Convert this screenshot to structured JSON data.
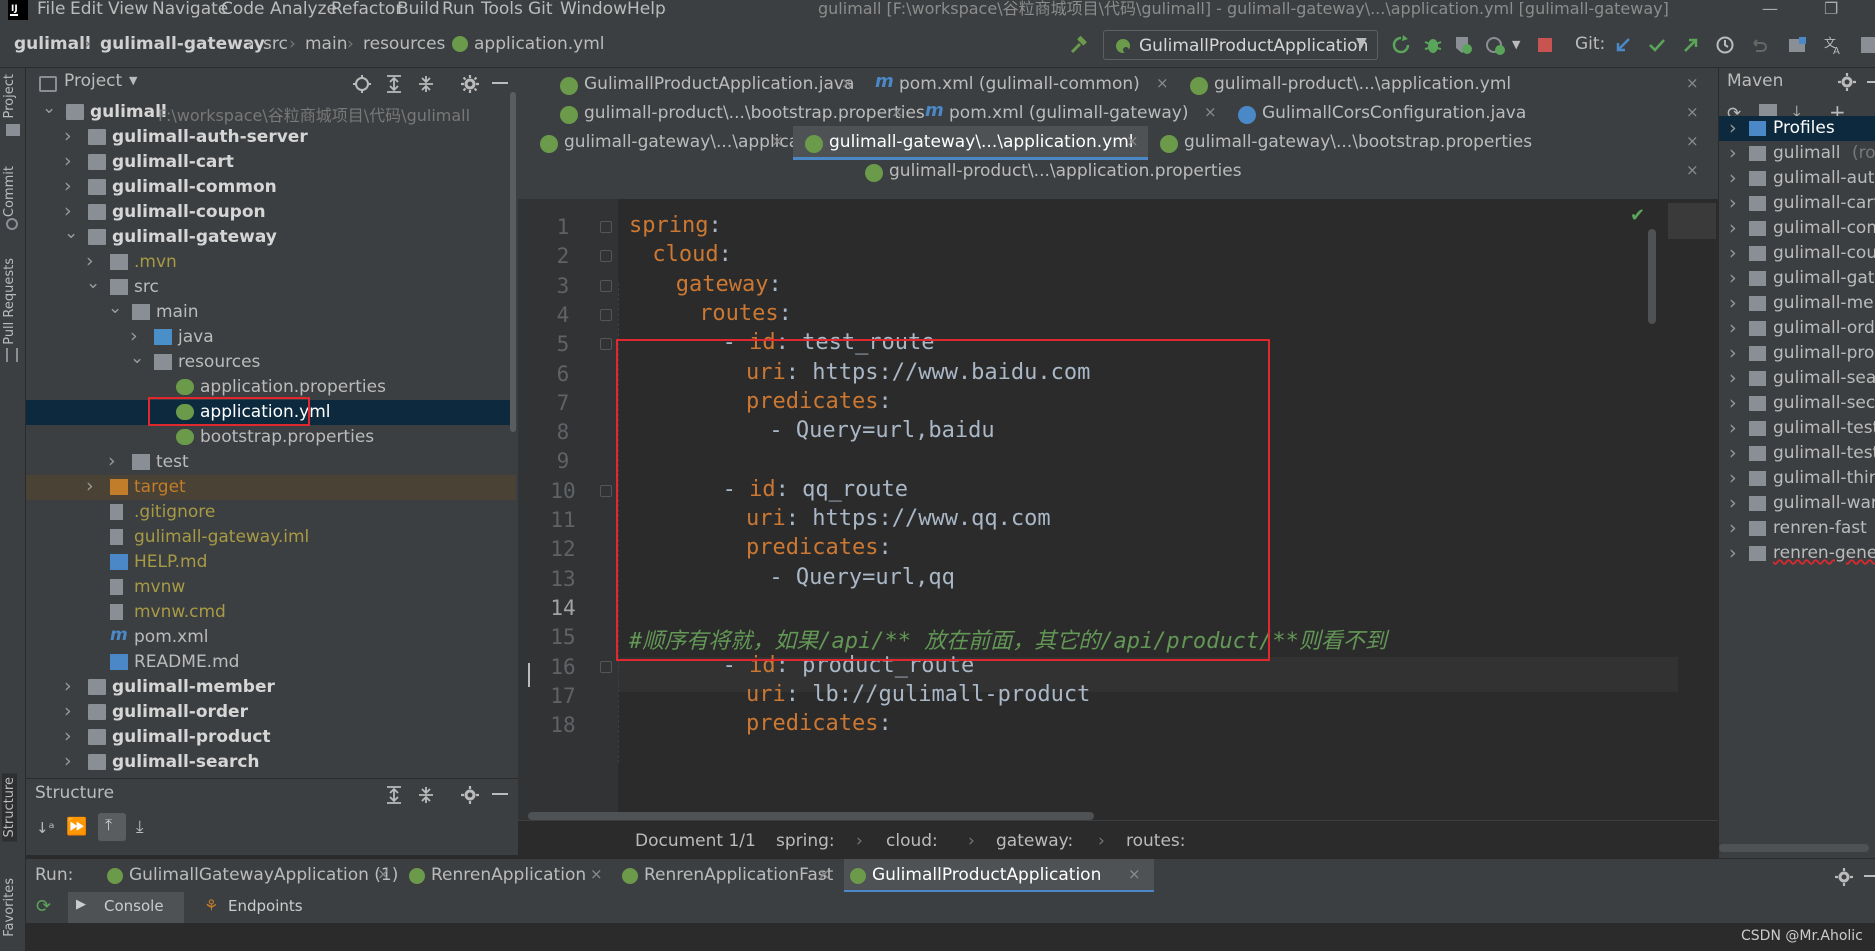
{
  "menubar": {
    "items": [
      "File",
      "Edit",
      "View",
      "Navigate",
      "Code",
      "Analyze",
      "Refactor",
      "Build",
      "Run",
      "Tools",
      "Git",
      "Window",
      "Help"
    ],
    "window_title": "gulimall [F:\\workspace\\谷粒商城项目\\代码\\gulimall] - gulimall-gateway\\...\\application.yml [gulimall-gateway]"
  },
  "navbar": {
    "breadcrumbs": [
      "gulimall",
      "gulimall-gateway",
      "src",
      "main",
      "resources",
      "application.yml"
    ],
    "run_config": "GulimallProductApplication",
    "git_label": "Git:"
  },
  "left_strip": {
    "tabs": [
      "Project",
      "Commit",
      "Pull Requests",
      "Structure",
      "Favorites"
    ]
  },
  "project": {
    "title": "Project",
    "tree": [
      {
        "label": "gulimall",
        "extra": "F:\\workspace\\谷粒商城项目\\代码\\gulimall",
        "depth": 0,
        "expanded": true,
        "bold": true,
        "kind": "module"
      },
      {
        "label": "gulimall-auth-server",
        "depth": 1,
        "expanded": false,
        "bold": true,
        "kind": "module"
      },
      {
        "label": "gulimall-cart",
        "depth": 1,
        "expanded": false,
        "bold": true,
        "kind": "module"
      },
      {
        "label": "gulimall-common",
        "depth": 1,
        "expanded": false,
        "bold": true,
        "kind": "module"
      },
      {
        "label": "gulimall-coupon",
        "depth": 1,
        "expanded": false,
        "bold": true,
        "kind": "module"
      },
      {
        "label": "gulimall-gateway",
        "depth": 1,
        "expanded": true,
        "bold": true,
        "kind": "module"
      },
      {
        "label": ".mvn",
        "depth": 2,
        "expanded": false,
        "kind": "folder",
        "color": "#a89a45"
      },
      {
        "label": "src",
        "depth": 2,
        "expanded": true,
        "kind": "folder"
      },
      {
        "label": "main",
        "depth": 3,
        "expanded": true,
        "kind": "folder"
      },
      {
        "label": "java",
        "depth": 4,
        "expanded": false,
        "kind": "blue-folder"
      },
      {
        "label": "resources",
        "depth": 4,
        "expanded": true,
        "kind": "res-folder"
      },
      {
        "label": "application.properties",
        "depth": 5,
        "kind": "spring-file"
      },
      {
        "label": "application.yml",
        "depth": 5,
        "kind": "spring-file",
        "selected": true
      },
      {
        "label": "bootstrap.properties",
        "depth": 5,
        "kind": "spring-file"
      },
      {
        "label": "test",
        "depth": 3,
        "expanded": false,
        "kind": "folder"
      },
      {
        "label": "target",
        "depth": 2,
        "expanded": false,
        "kind": "orange-folder",
        "color": "#c27d2a",
        "highlight": true
      },
      {
        "label": ".gitignore",
        "depth": 2,
        "kind": "file",
        "color": "#a89a45"
      },
      {
        "label": "gulimall-gateway.iml",
        "depth": 2,
        "kind": "file",
        "color": "#a89a45"
      },
      {
        "label": "HELP.md",
        "depth": 2,
        "kind": "md-file",
        "color": "#a89a45"
      },
      {
        "label": "mvnw",
        "depth": 2,
        "kind": "file",
        "color": "#a89a45"
      },
      {
        "label": "mvnw.cmd",
        "depth": 2,
        "kind": "file",
        "color": "#a89a45"
      },
      {
        "label": "pom.xml",
        "depth": 2,
        "kind": "maven-file"
      },
      {
        "label": "README.md",
        "depth": 2,
        "kind": "md-file"
      },
      {
        "label": "gulimall-member",
        "depth": 1,
        "expanded": false,
        "bold": true,
        "kind": "module"
      },
      {
        "label": "gulimall-order",
        "depth": 1,
        "expanded": false,
        "bold": true,
        "kind": "module"
      },
      {
        "label": "gulimall-product",
        "depth": 1,
        "expanded": false,
        "bold": true,
        "kind": "module"
      },
      {
        "label": "gulimall-search",
        "depth": 1,
        "expanded": false,
        "bold": true,
        "kind": "module"
      }
    ]
  },
  "structure": {
    "title": "Structure"
  },
  "tabs": {
    "row1": [
      {
        "label": "GulimallProductApplication.java",
        "icon": "spring"
      },
      {
        "label": "pom.xml (gulimall-common)",
        "icon": "maven"
      },
      {
        "label": "gulimall-product\\...\\application.yml",
        "icon": "spring"
      }
    ],
    "row2": [
      {
        "label": "gulimall-product\\...\\bootstrap.properties",
        "icon": "spring"
      },
      {
        "label": "pom.xml (gulimall-gateway)",
        "icon": "maven"
      },
      {
        "label": "GulimallCorsConfiguration.java",
        "icon": "class"
      }
    ],
    "row3": [
      {
        "label": "gulimall-gateway\\...\\application.properties",
        "icon": "spring"
      },
      {
        "label": "gulimall-gateway\\...\\application.yml",
        "icon": "spring",
        "active": true
      },
      {
        "label": "gulimall-gateway\\...\\bootstrap.properties",
        "icon": "spring"
      }
    ],
    "row4": [
      {
        "label": "gulimall-product\\...\\application.properties",
        "icon": "spring"
      }
    ]
  },
  "editor": {
    "lines": [
      {
        "n": "1",
        "indent": 0,
        "parts": [
          [
            "k",
            "spring"
          ],
          [
            "p",
            ":"
          ]
        ]
      },
      {
        "n": "2",
        "indent": 2,
        "parts": [
          [
            "k",
            "cloud"
          ],
          [
            "p",
            ":"
          ]
        ]
      },
      {
        "n": "3",
        "indent": 4,
        "parts": [
          [
            "k",
            "gateway"
          ],
          [
            "p",
            ":"
          ]
        ]
      },
      {
        "n": "4",
        "indent": 6,
        "parts": [
          [
            "k",
            "routes"
          ],
          [
            "p",
            ":"
          ]
        ]
      },
      {
        "n": "5",
        "indent": 8,
        "parts": [
          [
            "p",
            "- "
          ],
          [
            "k",
            "id"
          ],
          [
            "p",
            ": test_route"
          ]
        ]
      },
      {
        "n": "6",
        "indent": 10,
        "parts": [
          [
            "k",
            "uri"
          ],
          [
            "p",
            ": https://www.baidu.com"
          ]
        ]
      },
      {
        "n": "7",
        "indent": 10,
        "parts": [
          [
            "k",
            "predicates"
          ],
          [
            "p",
            ":"
          ]
        ]
      },
      {
        "n": "8",
        "indent": 12,
        "parts": [
          [
            "p",
            "- Query=url,baidu"
          ]
        ]
      },
      {
        "n": "9",
        "indent": 0,
        "parts": []
      },
      {
        "n": "10",
        "indent": 8,
        "parts": [
          [
            "p",
            "- "
          ],
          [
            "k",
            "id"
          ],
          [
            "p",
            ": qq_route"
          ]
        ]
      },
      {
        "n": "11",
        "indent": 10,
        "parts": [
          [
            "k",
            "uri"
          ],
          [
            "p",
            ": https://www.qq.com"
          ]
        ]
      },
      {
        "n": "12",
        "indent": 10,
        "parts": [
          [
            "k",
            "predicates"
          ],
          [
            "p",
            ":"
          ]
        ]
      },
      {
        "n": "13",
        "indent": 12,
        "parts": [
          [
            "p",
            "- Query=url,qq"
          ]
        ]
      },
      {
        "n": "14",
        "indent": 0,
        "parts": []
      },
      {
        "n": "15",
        "indent": 0,
        "parts": [
          [
            "c",
            "#顺序有将就，如果/api/** 放在前面，其它的/api/product/**则看不到"
          ]
        ]
      },
      {
        "n": "16",
        "indent": 8,
        "parts": [
          [
            "p",
            "- "
          ],
          [
            "k",
            "id"
          ],
          [
            "p",
            ": product_route"
          ]
        ]
      },
      {
        "n": "17",
        "indent": 10,
        "parts": [
          [
            "k",
            "uri"
          ],
          [
            "p",
            ": lb://gulimall-product"
          ]
        ]
      },
      {
        "n": "18",
        "indent": 10,
        "parts": [
          [
            "k",
            "predicates"
          ],
          [
            "p",
            ":"
          ]
        ]
      }
    ],
    "current_line": "14"
  },
  "crumbbar": [
    "Document 1/1",
    "spring:",
    "cloud:",
    "gateway:",
    "routes:"
  ],
  "maven": {
    "title": "Maven",
    "items": [
      {
        "label": "Profiles",
        "kind": "profiles",
        "selected": true
      },
      {
        "label": "gulimall",
        "suffix": "(root)"
      },
      {
        "label": "gulimall-auth"
      },
      {
        "label": "gulimall-cart"
      },
      {
        "label": "gulimall-comm"
      },
      {
        "label": "gulimall-coup"
      },
      {
        "label": "gulimall-gatew"
      },
      {
        "label": "gulimall-mem"
      },
      {
        "label": "gulimall-order"
      },
      {
        "label": "gulimall-prod"
      },
      {
        "label": "gulimall-searc"
      },
      {
        "label": "gulimall-secki"
      },
      {
        "label": "gulimall-test-"
      },
      {
        "label": "gulimall-test-"
      },
      {
        "label": "gulimall-third"
      },
      {
        "label": "gulimall-ware"
      },
      {
        "label": "renren-fast"
      },
      {
        "label": "renren-genera",
        "error": true
      }
    ]
  },
  "runbar": {
    "label": "Run:",
    "tabs": [
      "GulimallGatewayApplication (1)",
      "RenrenApplication",
      "RenrenApplicationFast",
      "GulimallProductApplication"
    ],
    "active_index": 3,
    "sub_tabs": [
      "Console",
      "Endpoints"
    ]
  },
  "watermark": "CSDN @Mr.Aholic",
  "colors": {
    "accent": "#4a88c7",
    "keyword": "#cc7832",
    "plain": "#a9b7c6",
    "comment": "#629755",
    "highlight_box": "#e0282e"
  }
}
